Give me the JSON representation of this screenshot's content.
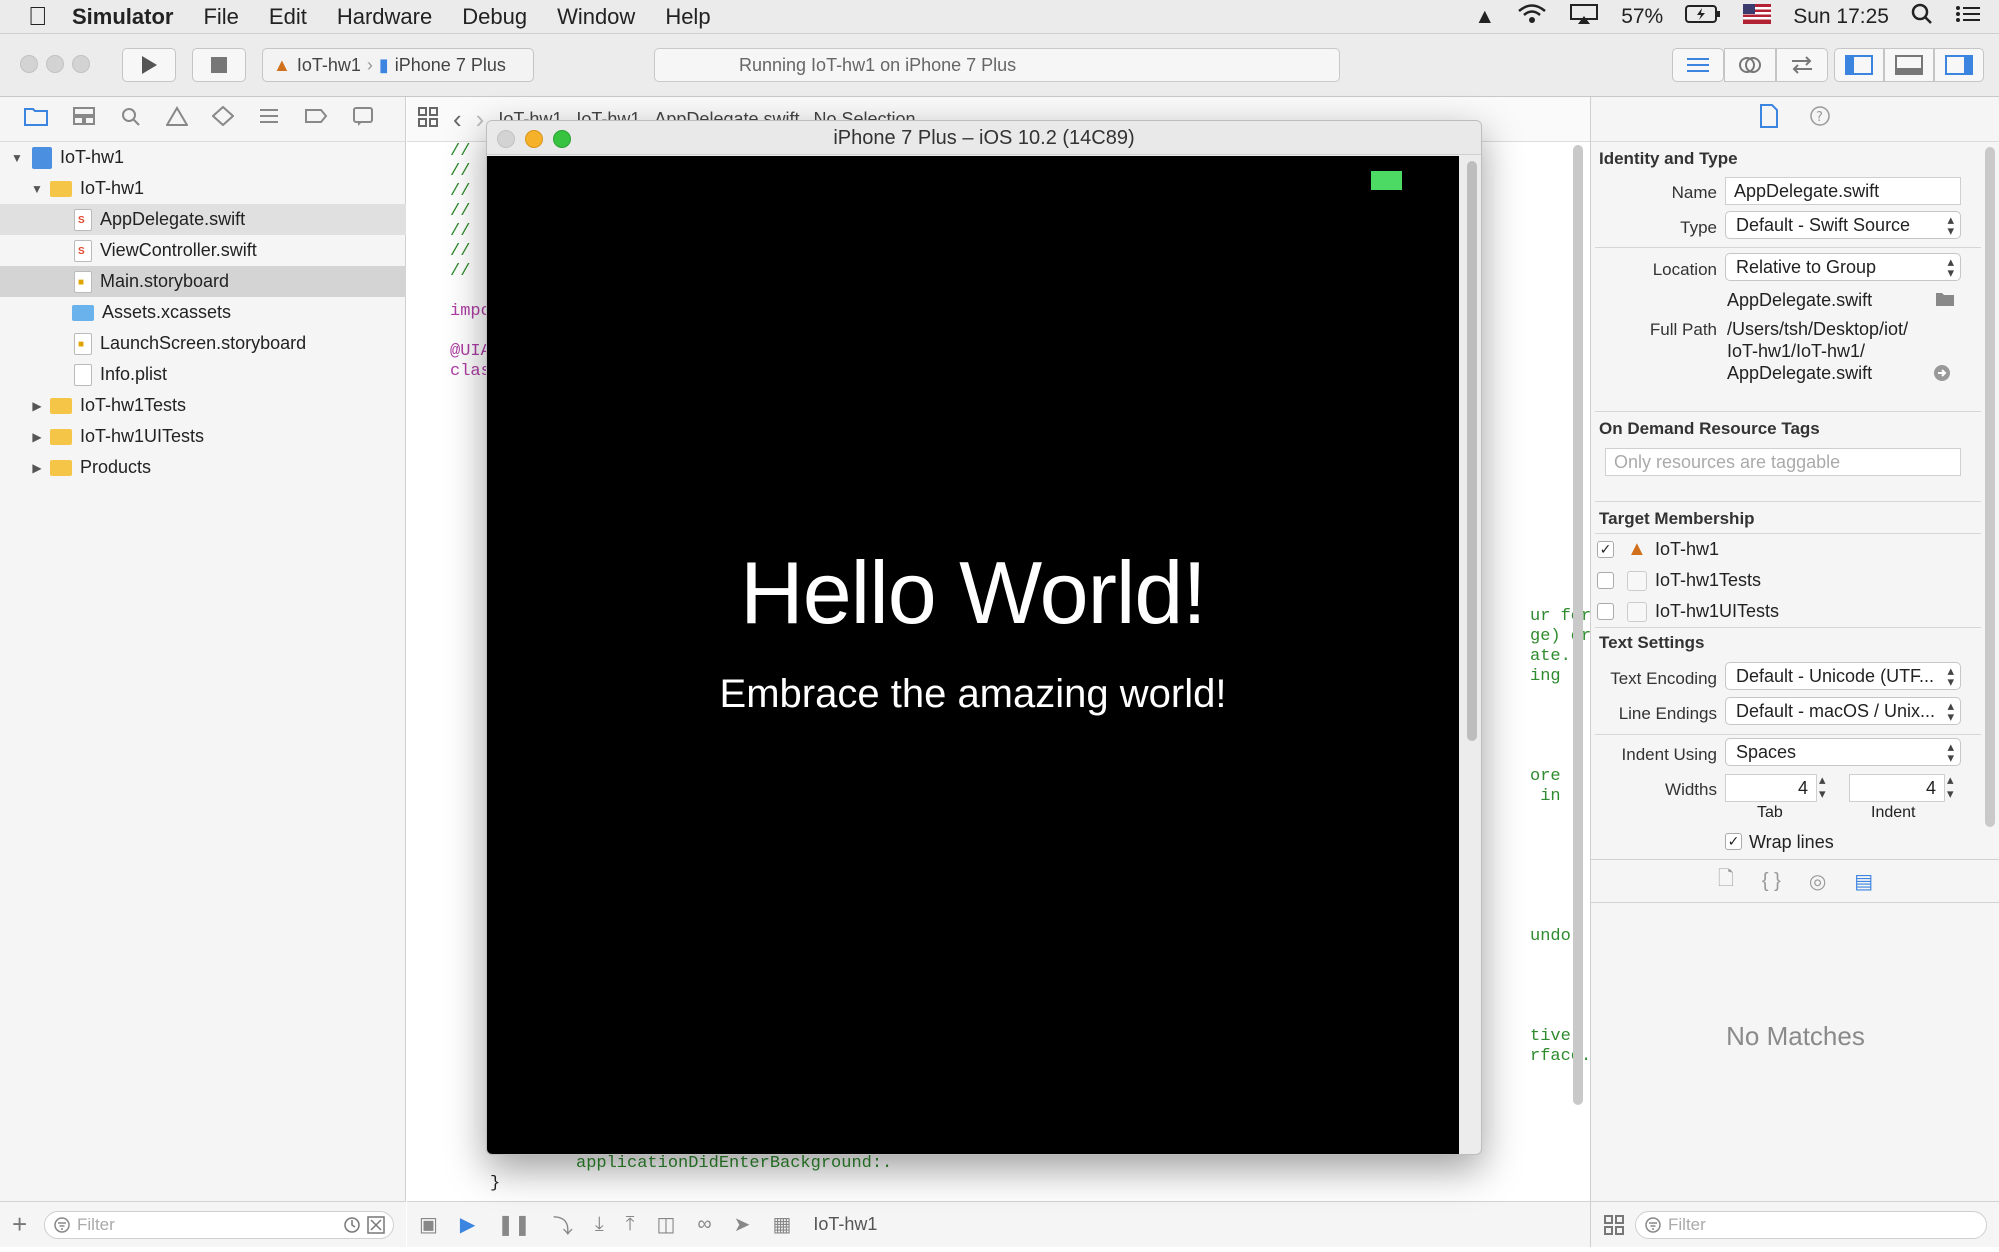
{
  "menubar": {
    "app_name": "Simulator",
    "items": [
      "File",
      "Edit",
      "Hardware",
      "Debug",
      "Window",
      "Help"
    ],
    "battery": "57%",
    "clock": "Sun 17:25"
  },
  "toolbar": {
    "scheme": "IoT-hw1",
    "device": "iPhone 7 Plus",
    "activity": "Running IoT-hw1 on iPhone 7 Plus"
  },
  "navigator": {
    "tree": [
      {
        "label": "IoT-hw1"
      },
      {
        "label": "IoT-hw1"
      },
      {
        "label": "AppDelegate.swift"
      },
      {
        "label": "ViewController.swift"
      },
      {
        "label": "Main.storyboard"
      },
      {
        "label": "Assets.xcassets"
      },
      {
        "label": "LaunchScreen.storyboard"
      },
      {
        "label": "Info.plist"
      },
      {
        "label": "IoT-hw1Tests"
      },
      {
        "label": "IoT-hw1UITests"
      },
      {
        "label": "Products"
      }
    ],
    "filter_placeholder": "Filter"
  },
  "editor": {
    "jumpbar": [
      "IoT-hw1",
      "IoT-hw1",
      "AppDelegate.swift",
      "No Selection"
    ],
    "code_left": {
      "comment": "//",
      "import": "impo",
      "attr": "@UIA",
      "class": "clas"
    },
    "code_right": [
      "ur for",
      "ge) or",
      "ate.",
      "ing",
      "ore",
      " in",
      "undo",
      "tive.",
      "rface."
    ],
    "code_bottom": "applicationDidEnterBackground:.",
    "brace": "}",
    "bottom_target": "IoT-hw1"
  },
  "simulator": {
    "title": "iPhone 7 Plus – iOS 10.2 (14C89)",
    "hello": "Hello World!",
    "subtitle": "Embrace the amazing world!"
  },
  "inspector": {
    "identity_title": "Identity and Type",
    "name_label": "Name",
    "name_value": "AppDelegate.swift",
    "type_label": "Type",
    "type_value": "Default - Swift Source",
    "location_label": "Location",
    "location_value": "Relative to Group",
    "location_file": "AppDelegate.swift",
    "fullpath_label": "Full Path",
    "fullpath_lines": [
      "/Users/tsh/Desktop/iot/",
      "IoT-hw1/IoT-hw1/",
      "AppDelegate.swift"
    ],
    "ondemand_title": "On Demand Resource Tags",
    "tags_placeholder": "Only resources are taggable",
    "target_title": "Target Membership",
    "targets": [
      {
        "label": "IoT-hw1",
        "checked": "✓"
      },
      {
        "label": "IoT-hw1Tests",
        "checked": ""
      },
      {
        "label": "IoT-hw1UITests",
        "checked": ""
      }
    ],
    "text_title": "Text Settings",
    "encoding_label": "Text Encoding",
    "encoding_value": "Default - Unicode (UTF...",
    "endings_label": "Line Endings",
    "endings_value": "Default - macOS / Unix...",
    "indent_label": "Indent Using",
    "indent_value": "Spaces",
    "widths_label": "Widths",
    "tab_value": "4",
    "indent_width_value": "4",
    "tab_caption": "Tab",
    "indent_caption": "Indent",
    "wrap_label": "Wrap lines",
    "wrap_checked": "✓",
    "no_matches": "No Matches",
    "filter_placeholder": "Filter"
  }
}
